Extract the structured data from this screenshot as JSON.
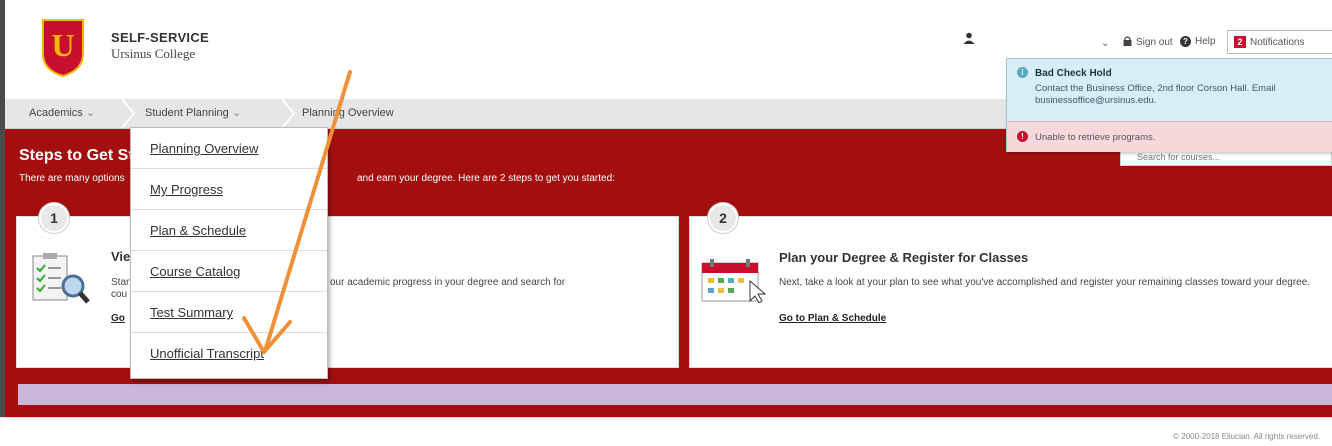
{
  "header": {
    "brand_line1": "SELF-SERVICE",
    "brand_line2": "Ursinus College",
    "logo_letter": "U",
    "sign_out": "Sign out",
    "help": "Help",
    "notifications": "Notifications",
    "notification_badge": "2"
  },
  "nav": {
    "academics": "Academics",
    "student_planning": "Student Planning",
    "planning_overview": "Planning Overview"
  },
  "main": {
    "title": "Steps to Get Started",
    "subtitle_left": "There are many options",
    "subtitle_right": "and earn your degree. Here are 2 steps to get you started:"
  },
  "cards": [
    {
      "number": "1",
      "title": "View Your Progress",
      "text_left": "Start",
      "text_right": "our academic progress in your degree and search for",
      "text_left2": "cou",
      "link": "Go"
    },
    {
      "number": "2",
      "title": "Plan your Degree & Register for Classes",
      "text": "Next, take a look at your plan to see what you've accomplished and register your remaining classes toward your degree.",
      "link": "Go to Plan & Schedule"
    }
  ],
  "dropdown": {
    "items": [
      "Planning Overview",
      "My Progress",
      "Plan & Schedule",
      "Course Catalog",
      "Test Summary",
      "Unofficial Transcript"
    ]
  },
  "search": {
    "placeholder": "Search for courses..."
  },
  "notifications_popup": {
    "info_title": "Bad Check Hold",
    "info_body": "Contact the Business Office, 2nd floor Corson Hall. Email businessoffice@ursinus.edu.",
    "error_text": "Unable to retrieve programs."
  },
  "footer": {
    "text": "© 2000-2018 Ellucian. All rights reserved."
  },
  "colors": {
    "brand_red": "#a30f0f",
    "annotation_arrow": "#f0913a"
  }
}
